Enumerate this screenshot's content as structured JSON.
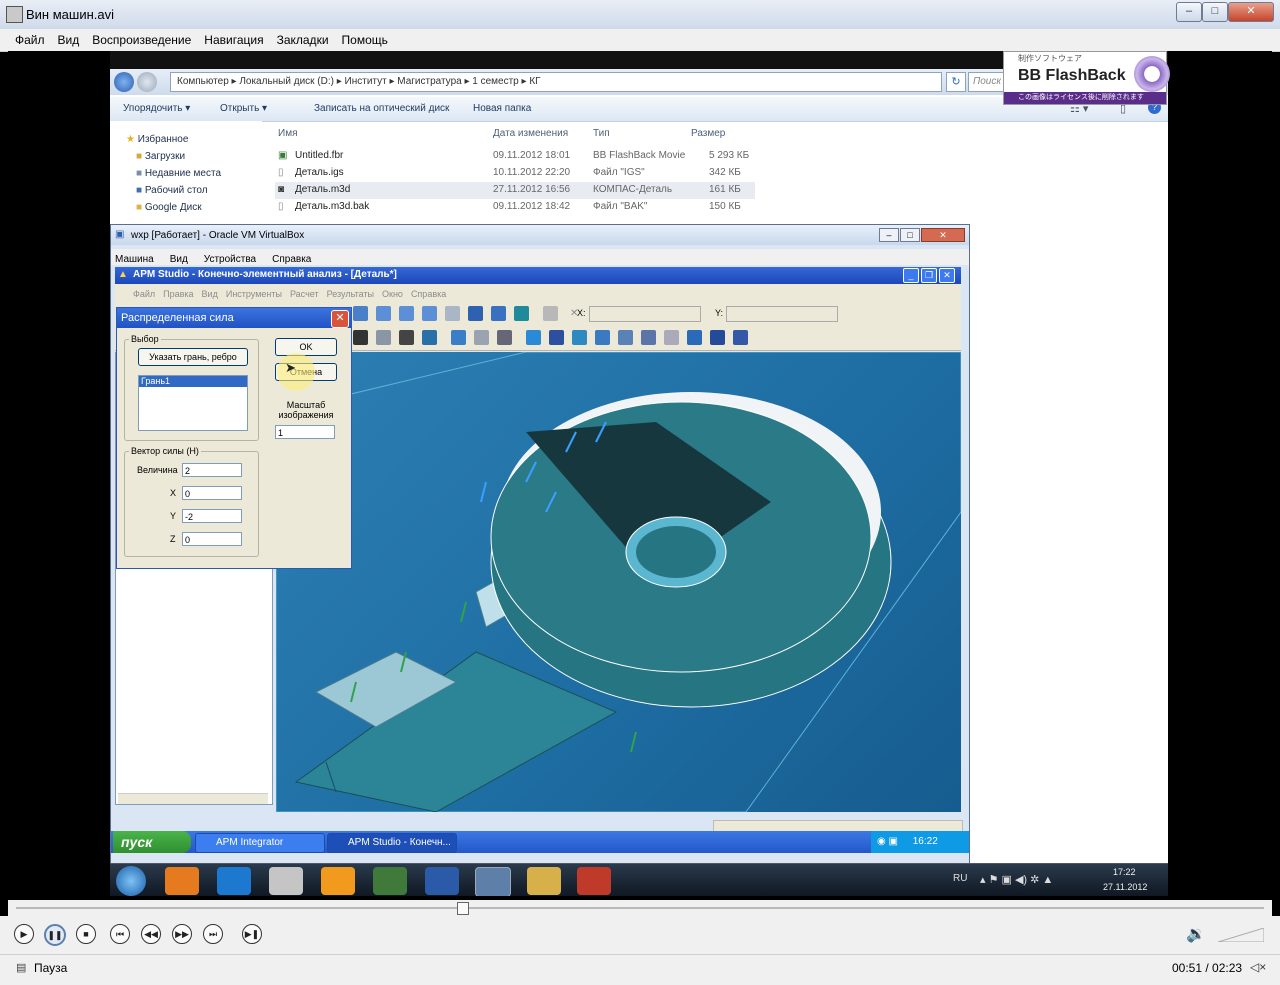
{
  "player": {
    "title": "Вин машин.avi",
    "menu": [
      "Файл",
      "Вид",
      "Воспроизведение",
      "Навигация",
      "Закладки",
      "Помощь"
    ],
    "status": "Пауза",
    "time": "00:51 / 02:23",
    "progress_fraction": 0.357
  },
  "explorer": {
    "breadcrumb": "Компьютер  ▸  Локальный диск (D:)  ▸  Институт  ▸  Магистратура  ▸  1 семестр  ▸  КГ",
    "search_placeholder": "Поиск",
    "toolbar": [
      "Упорядочить ▾",
      "Открыть ▾",
      "Записать на оптический диск",
      "Новая папка"
    ],
    "sidebar_header": "Избранное",
    "sidebar": [
      "Загрузки",
      "Недавние места",
      "Рабочий стол",
      "Google Диск"
    ],
    "columns": [
      "Имя",
      "Дата изменения",
      "Тип",
      "Размер"
    ],
    "files": [
      {
        "name": "Untitled.fbr",
        "date": "09.11.2012 18:01",
        "type": "BB FlashBack Movie",
        "size": "5 293 КБ"
      },
      {
        "name": "Деталь.igs",
        "date": "10.11.2012 22:20",
        "type": "Файл \"IGS\"",
        "size": "342 КБ"
      },
      {
        "name": "Деталь.m3d",
        "date": "27.11.2012 16:56",
        "type": "КОМПАС-Деталь",
        "size": "161 КБ"
      },
      {
        "name": "Деталь.m3d.bak",
        "date": "09.11.2012 18:42",
        "type": "Файл \"BAK\"",
        "size": "150 КБ"
      }
    ]
  },
  "flashback": {
    "top": "制作ソフトウェア",
    "name": "BB FlashBack",
    "bottom": "この画像はライセンス後に削除されます"
  },
  "vbox": {
    "title": "wxp [Работает] - Oracle VM VirtualBox",
    "menu": [
      "Машина",
      "Вид",
      "Устройства",
      "Справка"
    ]
  },
  "apm": {
    "title": "APM Studio - Конечно-элементный анализ - [Деталь*]",
    "menu": [
      "Файл",
      "Правка",
      "Вид",
      "Инструменты",
      "Расчет",
      "Результаты",
      "Окно",
      "Справка"
    ],
    "x_label": "X:",
    "y_label": "Y:"
  },
  "dialog": {
    "title": "Распределенная сила",
    "group_select": "Выбор",
    "pick_button": "Указать грань, ребро",
    "list_item": "Грань1",
    "ok": "OK",
    "cancel": "Отмена",
    "scale_label": "Масштаб изображения",
    "scale_value": "1",
    "group_vector": "Вектор силы (Н)",
    "magnitude_label": "Величина",
    "magnitude_value": "2",
    "x_label": "X",
    "x_value": "0",
    "y_label": "Y",
    "y_value": "-2",
    "z_label": "Z",
    "z_value": "0"
  },
  "xp_taskbar": {
    "start": "пуск",
    "task1": "APM Integrator",
    "task2": "APM Studio - Конечн...",
    "clock": "16:22"
  },
  "w7_taskbar": {
    "lang": "RU",
    "time": "17:22",
    "date": "27.11.2012"
  }
}
